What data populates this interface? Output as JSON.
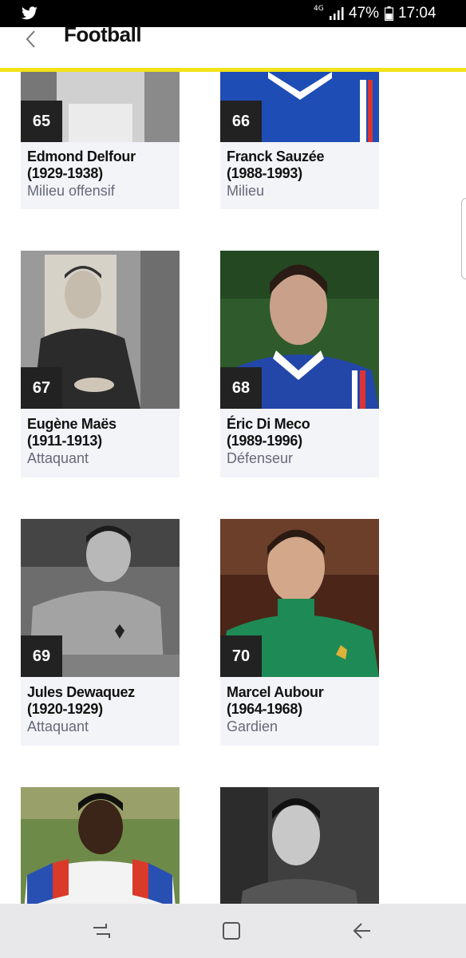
{
  "status_bar": {
    "network": "4G",
    "battery": "47%",
    "time": "17:04",
    "icons": [
      "twitter-icon",
      "signal-icon",
      "battery-icon"
    ]
  },
  "header": {
    "title": "Football",
    "back_icon": "chevron-left-icon"
  },
  "players": [
    {
      "num": "65",
      "name": "Edmond Delfour",
      "years": "(1929-1938)",
      "position": "Milieu offensif"
    },
    {
      "num": "66",
      "name": "Franck Sauzée",
      "years": "(1988-1993)",
      "position": "Milieu"
    },
    {
      "num": "67",
      "name": "Eugène Maës",
      "years": "(1911-1913)",
      "position": "Attaquant"
    },
    {
      "num": "68",
      "name": "Éric Di Meco",
      "years": "(1989-1996)",
      "position": "Défenseur"
    },
    {
      "num": "69",
      "name": "Jules Dewaquez",
      "years": "(1920-1929)",
      "position": "Attaquant"
    },
    {
      "num": "70",
      "name": "Marcel Aubour",
      "years": "(1964-1968)",
      "position": "Gardien"
    }
  ],
  "nav_bar": {
    "icons": [
      "recent-apps-icon",
      "home-icon",
      "back-icon"
    ]
  },
  "colors": {
    "accent": "#f2e218",
    "card_bg": "#f3f4f8",
    "number_badge": "#222222",
    "position_text": "#666a78"
  }
}
